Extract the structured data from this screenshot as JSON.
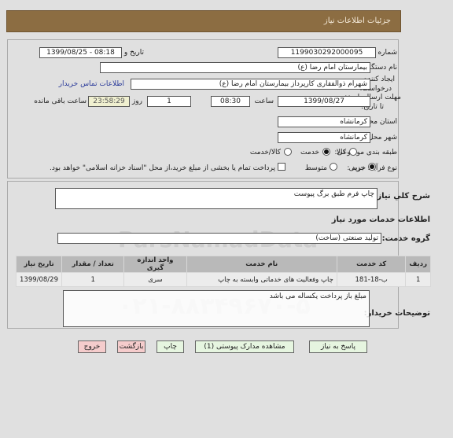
{
  "header": {
    "title": "جزئیات اطلاعات نیاز"
  },
  "need_info": {
    "need_number_label": "شماره نیاز:",
    "need_number": "1199030292000095",
    "announce_label": "تاریخ و ساعت اعلان عمومی:",
    "announce_value": "1399/08/25 - 08:18",
    "buyer_org_label": "نام دستگاه خریدار:",
    "buyer_org": "بیمارستان امام رضا (ع)",
    "creator_label_line1": "ایجاد کننده",
    "creator_label_line2": "درخواست:",
    "creator": "شهرام ذوالفقاری کارپرداز بیمارستان امام رضا (ع)",
    "contact_link": "اطلاعات تماس خریدار",
    "deadline_label_line1": "مهلت ارسال پاسخ:",
    "deadline_label_line2": "تا تاریخ:",
    "deadline_date": "1399/08/27",
    "time_label": "ساعت",
    "deadline_time": "08:30",
    "days_value": "1",
    "days_label": "روز و",
    "remaining_time": "23:58:29",
    "remaining_label": "ساعت باقی مانده",
    "province_label": "استان محل تحویل:",
    "province": "کرمانشاه",
    "city_label": "شهر محل تحویل:",
    "city": "کرمانشاه",
    "category_label": "طبقه بندی موضوعی:",
    "category_options": [
      {
        "label": "کالا",
        "selected": false
      },
      {
        "label": "خدمت",
        "selected": true
      },
      {
        "label": "کالا/خدمت",
        "selected": false
      }
    ],
    "process_label": "نوع فرآیند خرید :",
    "process_options": [
      {
        "label": "جزیی",
        "selected": true
      },
      {
        "label": "متوسط",
        "selected": false
      }
    ],
    "treasury_checkbox_checked": false,
    "treasury_text": "پرداخت تمام یا بخشی از مبلغ خرید،از محل \"اسناد خزانه اسلامی\" خواهد بود."
  },
  "details": {
    "general_desc_label": "شرح کلي نیاز:",
    "general_desc": "چاپ فرم طبق برگ پیوست",
    "services_section_title": "اطلاعات خدمات مورد نیاز",
    "service_group_label": "گروه خدمت:",
    "service_group": "تولید صنعتی (ساخت)",
    "table": {
      "headers": [
        "ردیف",
        "کد خدمت",
        "نام خدمت",
        "واحد اندازه گیری",
        "تعداد / مقدار",
        "تاریخ نیاز"
      ],
      "rows": [
        [
          "1",
          "ب-18-181",
          "چاپ وفعالیت های خدماتی وابسته به چاپ",
          "سری",
          "1",
          "1399/08/29"
        ]
      ]
    },
    "buyer_notes_label": "توضیحات خریدار:",
    "buyer_notes": "مبلغ باز پرداخت یکساله می باشد"
  },
  "buttons": {
    "reply": "پاسخ به نیاز",
    "view_attachments": "مشاهده مدارک پیوستی (1)",
    "print": "چاپ",
    "back": "بازگشت",
    "exit": "خروج"
  },
  "watermark": {
    "brand": "ParsNamadData",
    "phone": "۰۲۱-۸۸۳۴۹۶۷۰-۵"
  }
}
